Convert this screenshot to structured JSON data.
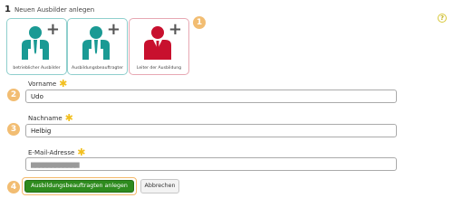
{
  "step": {
    "number": "1",
    "title": "Neuen Ausbilder anlegen"
  },
  "help_icon": "?",
  "cards": [
    {
      "label": "betrieblicher Ausbilder",
      "icon": "trainer-plus-icon",
      "color": "#1a9a94"
    },
    {
      "label": "Ausbildungsbeauftragter",
      "icon": "trainer-plus-icon",
      "color": "#1a9a94"
    },
    {
      "label": "Leiter der Ausbildung",
      "icon": "manager-plus-icon",
      "color": "#c8102e"
    }
  ],
  "badges": [
    "1",
    "2",
    "3",
    "4"
  ],
  "form": {
    "required_marker": "✱",
    "vorname": {
      "label": "Vorname",
      "value": "Udo"
    },
    "nachname": {
      "label": "Nachname",
      "value": "Helbig"
    },
    "email": {
      "label": "E-Mail-Adresse",
      "value": "▆▆▆▆▆▆▆▆▆▆▆▆"
    }
  },
  "buttons": {
    "submit": "Ausbildungsbeauftragten anlegen",
    "cancel": "Abbrechen"
  },
  "colors": {
    "accent_teal": "#1a9a94",
    "accent_red": "#c8102e",
    "badge_orange": "#f2bd72",
    "submit_green": "#2e8b1e"
  }
}
